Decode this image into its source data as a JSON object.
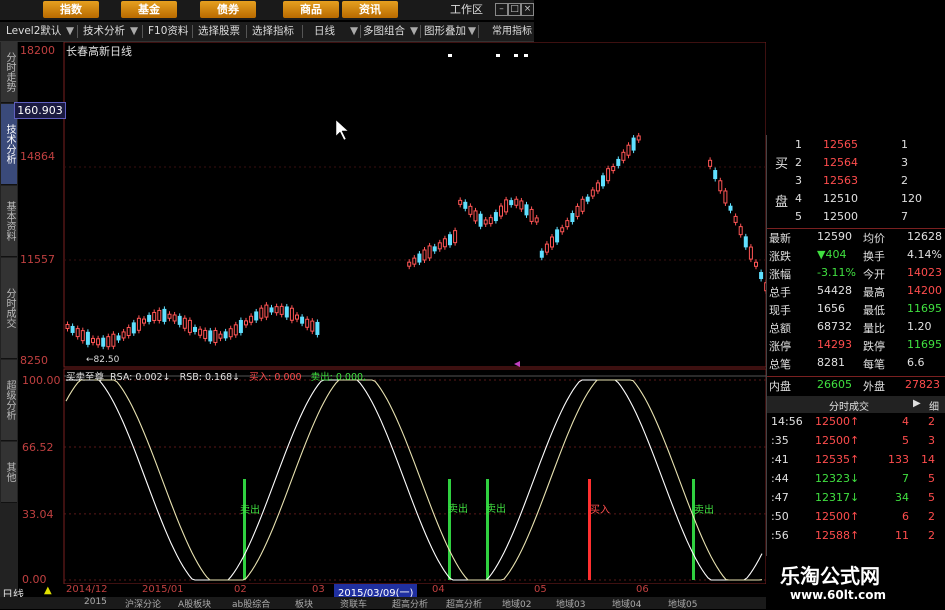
{
  "nav": {
    "buttons": [
      "指数",
      "基金",
      "债券",
      "商品",
      "资讯"
    ],
    "workarea": "工作区",
    "win_icons": [
      "–",
      "□",
      "×"
    ]
  },
  "toolbar": {
    "items": [
      "Level2默认",
      "技术分析",
      "F10资料",
      "选择股票",
      "选择指标",
      "日线",
      "多图组合",
      "图形叠加",
      "常用指标"
    ]
  },
  "sidebar": {
    "tabs": [
      "分时走势",
      "技术分析",
      "基本资料",
      "分时成交",
      "超级分析",
      "其他"
    ]
  },
  "main_chart": {
    "title": "长春高新日线",
    "price_ticks": [
      "18200",
      "14864",
      "11557",
      "8250"
    ],
    "current_price": "160.903",
    "min_label": "←82.50"
  },
  "chart_data": [
    {
      "type": "line",
      "title": "买卖至尊",
      "legend": {
        "rsa": "RSA: 0.002↓",
        "rsb": "RSB: 0.168↓",
        "buy": "买入: 0.000",
        "sell": "卖出: 0.000,"
      },
      "yticks": [
        "100.00",
        "66.52",
        "33.04",
        "0.00"
      ],
      "ylim": [
        0,
        100
      ],
      "signals": [
        {
          "label": "卖出",
          "kind": "sell"
        },
        {
          "label": "卖出",
          "kind": "sell"
        },
        {
          "label": "卖出",
          "kind": "sell"
        },
        {
          "label": "买入",
          "kind": "buy"
        },
        {
          "label": "卖出",
          "kind": "sell"
        }
      ]
    }
  ],
  "date_axis": {
    "labels": [
      "2014/12",
      "2015/01",
      "02",
      "03",
      "2015/03/09(一)",
      "04",
      "05",
      "06"
    ]
  },
  "bottom_tabs": [
    "日线",
    "2015",
    "沪深分论",
    "A股板块",
    "ab股综合",
    "板块",
    "资联车",
    "超高分析",
    "超高分析",
    "地域02",
    "地域03",
    "地域04",
    "地域05"
  ],
  "order_book": {
    "side_labels": [
      "买",
      "盘"
    ],
    "rows": [
      {
        "lvl": "1",
        "price": "12565",
        "vol": "1"
      },
      {
        "lvl": "2",
        "price": "12564",
        "vol": "3"
      },
      {
        "lvl": "3",
        "price": "12563",
        "vol": "2"
      },
      {
        "lvl": "4",
        "price": "12510",
        "vol": "120"
      },
      {
        "lvl": "5",
        "price": "12500",
        "vol": "7"
      }
    ]
  },
  "stats": [
    {
      "k1": "最新",
      "v1": "12590",
      "k2": "均价",
      "v2": "12628"
    },
    {
      "k1": "涨跌",
      "v1": "▼404",
      "k2": "换手",
      "v2": "4.14%"
    },
    {
      "k1": "涨幅",
      "v1": "-3.11%",
      "k2": "今开",
      "v2": "14023"
    },
    {
      "k1": "总手",
      "v1": "54428",
      "k2": "最高",
      "v2": "14200"
    },
    {
      "k1": "现手",
      "v1": "1656",
      "k2": "最低",
      "v2": "11695"
    },
    {
      "k1": "总额",
      "v1": "68732",
      "k2": "量比",
      "v2": "1.20"
    },
    {
      "k1": "涨停",
      "v1": "14293",
      "k2": "跌停",
      "v2": "11695"
    },
    {
      "k1": "总笔",
      "v1": "8281",
      "k2": "每笔",
      "v2": "6.6"
    }
  ],
  "inout": {
    "k1": "内盘",
    "v1": "26605",
    "k2": "外盘",
    "v2": "27823"
  },
  "trades_header": "分时成交",
  "trades_detail": "细",
  "trades": [
    {
      "time": "14:56",
      "price": "12500↑",
      "vol": "4",
      "n": "2"
    },
    {
      "time": ":35",
      "price": "12500↑",
      "vol": "5",
      "n": "3"
    },
    {
      "time": ":41",
      "price": "12535↑",
      "vol": "133",
      "n": "14"
    },
    {
      "time": ":44",
      "price": "12323↓",
      "vol": "7",
      "n": "5"
    },
    {
      "time": ":47",
      "price": "12317↓",
      "vol": "34",
      "n": "5"
    },
    {
      "time": ":50",
      "price": "12500↑",
      "vol": "6",
      "n": "2"
    },
    {
      "time": ":56",
      "price": "12588↑",
      "vol": "11",
      "n": "2"
    }
  ],
  "watermark": {
    "cn": "乐淘公式网",
    "url": "www.60lt.com"
  },
  "colors": {
    "up": "#ff4d4d",
    "down": "#40e0ff",
    "frame": "#7a2020",
    "accent": "#e6a020"
  }
}
